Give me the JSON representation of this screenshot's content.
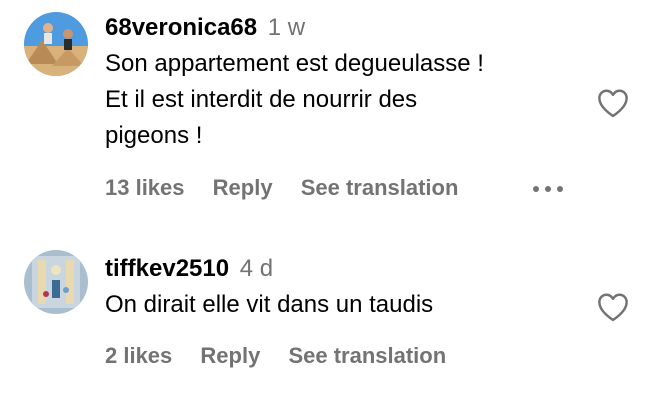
{
  "comments": [
    {
      "username": "68veronica68",
      "time": "1 w",
      "text_lines": [
        "Son appartement est degueulasse !",
        "Et il est interdit de nourrir des",
        "pigeons !"
      ],
      "likes": "13 likes",
      "reply": "Reply",
      "translate": "See translation",
      "avatar_icon": "user-avatar-icon",
      "like_icon": "heart-outline-icon",
      "more_icon": "more-horizontal-icon"
    },
    {
      "username": "tiffkev2510",
      "time": "4 d",
      "text_lines": [
        "On dirait elle vit dans un taudis"
      ],
      "likes": "2 likes",
      "reply": "Reply",
      "translate": "See translation",
      "avatar_icon": "user-avatar-icon",
      "like_icon": "heart-outline-icon"
    }
  ],
  "colors": {
    "text_primary": "#000000",
    "text_secondary": "#737373",
    "background": "#ffffff"
  }
}
